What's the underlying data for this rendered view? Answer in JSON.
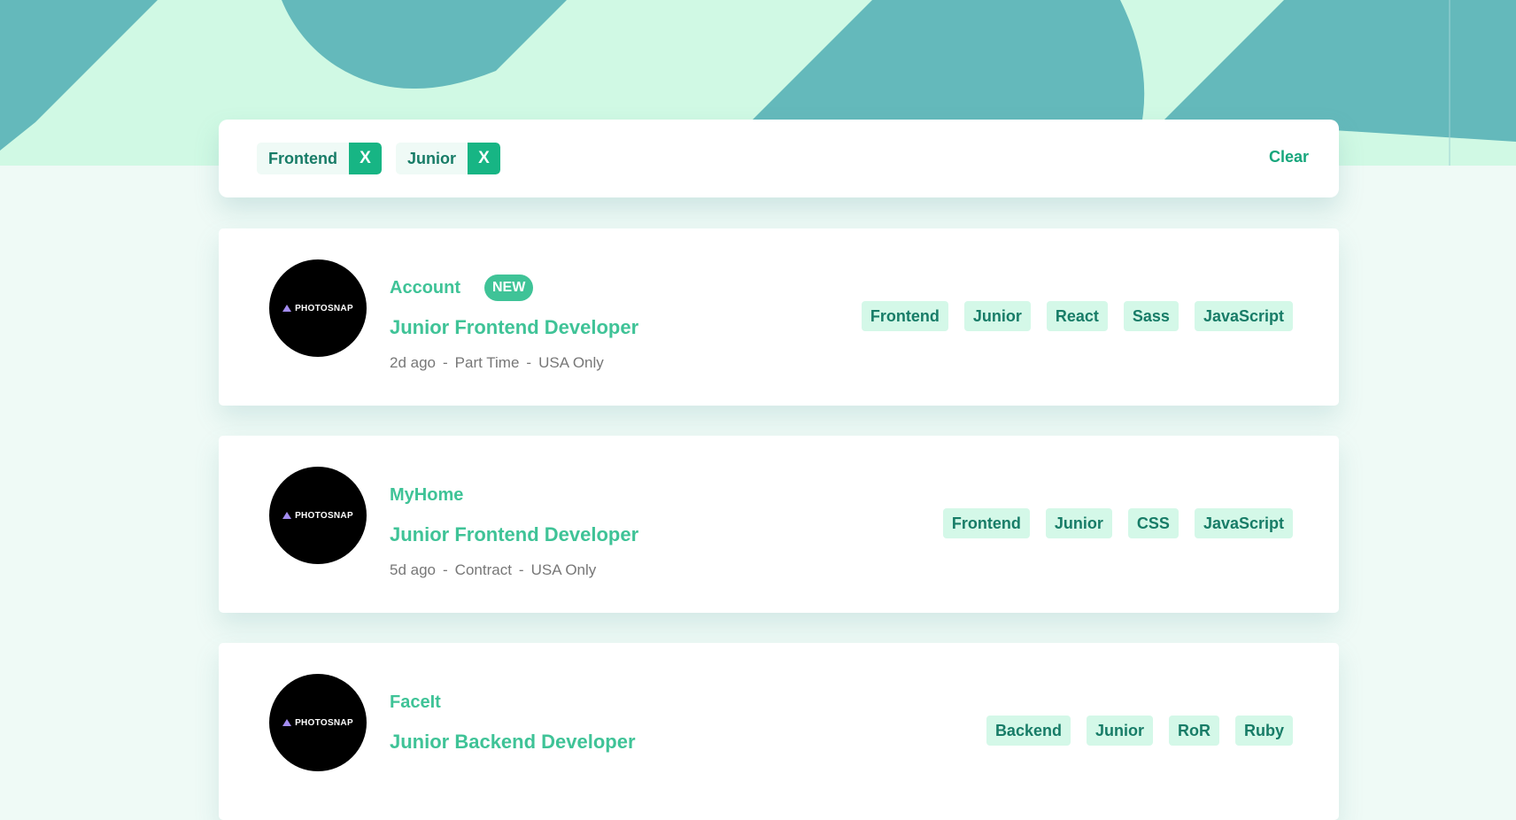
{
  "colors": {
    "header_light": "#d0f9e4",
    "header_shape": "#64b9bb",
    "page_bg": "#effaf6",
    "accent": "#3fc397",
    "tag_bg": "#d4f8e8",
    "tag_text": "#177c67",
    "chip_remove_bg": "#17b584"
  },
  "filters": {
    "chips": [
      {
        "label": "Frontend",
        "remove_label": "X"
      },
      {
        "label": "Junior",
        "remove_label": "X"
      }
    ],
    "clear_label": "Clear"
  },
  "jobs": [
    {
      "logo_text": "PHOTOSNAP",
      "company": "Account",
      "badge": "NEW",
      "position": "Junior Frontend Developer",
      "posted": "2d ago",
      "contract": "Part Time",
      "location": "USA Only",
      "separator": "-",
      "tags": [
        "Frontend",
        "Junior",
        "React",
        "Sass",
        "JavaScript"
      ]
    },
    {
      "logo_text": "PHOTOSNAP",
      "company": "MyHome",
      "position": "Junior Frontend Developer",
      "posted": "5d ago",
      "contract": "Contract",
      "location": "USA Only",
      "separator": "-",
      "tags": [
        "Frontend",
        "Junior",
        "CSS",
        "JavaScript"
      ]
    },
    {
      "logo_text": "PHOTOSNAP",
      "company": "FaceIt",
      "position": "Junior Backend Developer",
      "tags": [
        "Backend",
        "Junior",
        "RoR",
        "Ruby"
      ]
    }
  ]
}
